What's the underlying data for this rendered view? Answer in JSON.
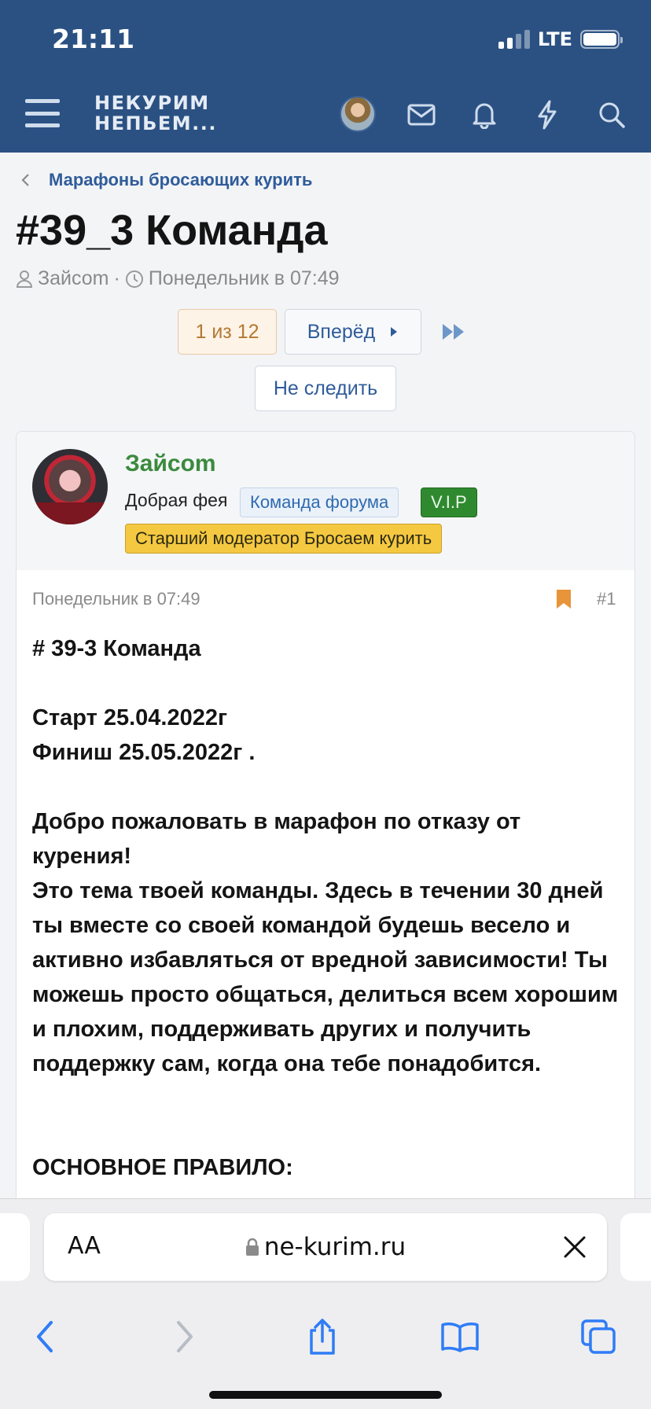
{
  "status_bar": {
    "time": "21:11",
    "network": "LTE"
  },
  "nav": {
    "logo_line1": "НЕКУРИМ",
    "logo_line2": "НЕПЬЕМ...",
    "icons": [
      "menu-icon",
      "avatar",
      "mail-icon",
      "bell-icon",
      "lightning-icon",
      "search-icon"
    ]
  },
  "breadcrumb": {
    "label": "Марафоны бросающих курить"
  },
  "thread": {
    "title": "#39_3 Команда",
    "author": "Зайсоm",
    "separator": "·",
    "date": "Понедельник в 07:49"
  },
  "pagination": {
    "current": "1 из 12",
    "next_label": "Вперёд"
  },
  "watch_button": {
    "label": "Не следить"
  },
  "post": {
    "username": "Зайсоm",
    "user_title": "Добрая фея",
    "banners": {
      "team": "Команда форума",
      "vip": "V.I.P",
      "moderator": "Старший модератор Бросаем курить"
    },
    "date": "Понедельник в 07:49",
    "number": "#1",
    "body": {
      "heading": "# 39-3 Команда",
      "start": "Старт 25.04.2022г",
      "finish": "Финиш 25.05.2022г .",
      "welcome": "Добро пожаловать в марафон по отказу от курения!",
      "description": "Это тема твоей команды. Здесь в течении 30 дней ты вместе со своей командой будешь весело и активно избавляться от вредной зависимости! Ты можешь просто общаться, делиться всем хорошим и плохим, поддерживать других и получить поддержку сам, когда она тебе понадобится.",
      "rules_heading": "ОСНОВНОЕ ПРАВИЛО:"
    }
  },
  "safari": {
    "text_size_label": "AA",
    "url": "ne-kurim.ru"
  },
  "colors": {
    "header_bg": "#2b5183",
    "link": "#2f5c9a",
    "username": "#3b8a3e",
    "vip": "#2f8a2f",
    "moderator": "#f5c842",
    "bookmark": "#e8943a"
  }
}
